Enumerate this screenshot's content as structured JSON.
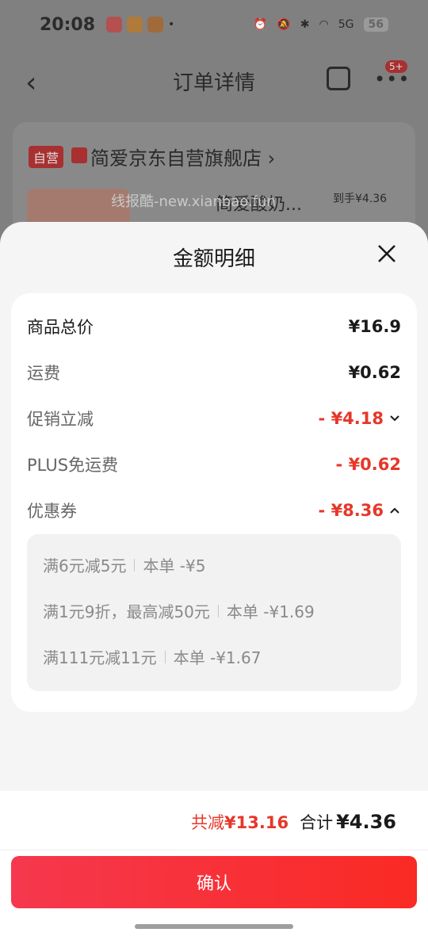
{
  "status_bar": {
    "time": "20:08",
    "battery": "56",
    "network": "5G"
  },
  "nav": {
    "title": "订单详情",
    "badge": "5+"
  },
  "store": {
    "self_tag": "自营",
    "name": "简爱京东自营旗舰店 ›",
    "product_name": "简爱酸奶...",
    "arrive_price": "到手¥4.36",
    "watermark": "线报酷-new.xianbao.fun"
  },
  "sheet": {
    "title": "金额明细",
    "rows": [
      {
        "label": "商品总价",
        "value": "¥16.9"
      },
      {
        "label": "运费",
        "value": "¥0.62"
      },
      {
        "label": "促销立减",
        "value": "- ¥4.18"
      },
      {
        "label": "PLUS免运费",
        "value": "- ¥0.62"
      },
      {
        "label": "优惠券",
        "value": "- ¥8.36"
      }
    ],
    "coupons": [
      {
        "name": "满6元减5元",
        "amount": "本单 -¥5"
      },
      {
        "name": "满1元9折，最高减50元",
        "amount": "本单 -¥1.69"
      },
      {
        "name": "满111元减11元",
        "amount": "本单 -¥1.67"
      }
    ]
  },
  "footer": {
    "saved_label": "共减",
    "saved_value": "¥13.16",
    "sum_label": "合计",
    "sum_value": "¥4.36",
    "confirm_label": "确认"
  },
  "colors": {
    "accent_red": "#e6372a",
    "button_start": "#f5384e",
    "button_end": "#fa2a24"
  }
}
